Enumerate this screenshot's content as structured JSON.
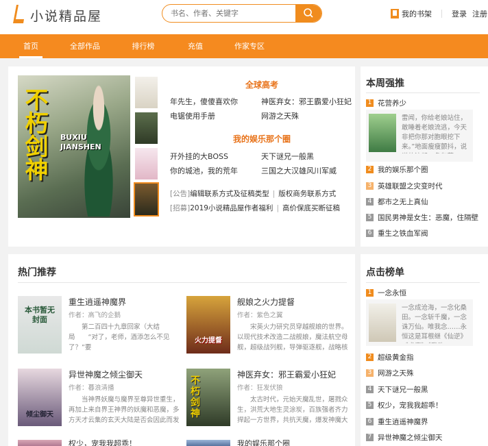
{
  "site": {
    "logo_text": "小说精品屋",
    "accent_color": "#f58a1f"
  },
  "header": {
    "search_placeholder": "书名、作者、关键字",
    "bookshelf_label": "我的书架",
    "login_label": "登录",
    "register_label": "注册"
  },
  "nav": {
    "items": [
      "首页",
      "全部作品",
      "排行榜",
      "充值",
      "作家专区"
    ],
    "active": "首页"
  },
  "featured": {
    "main_cover": {
      "big_text": "不朽剑神",
      "sub_text": "BUXIU JIANSHEN"
    },
    "section1": {
      "title": "全球高考",
      "links": [
        "年先生，傻傻喜欢你",
        "神医弃女：邪王霸爱小狂妃",
        "电锯使用手册",
        "网游之天殊"
      ]
    },
    "section2": {
      "title": "我的娱乐那个圈",
      "links": [
        "开外挂的大BOSS",
        "天下谜兄一般黑",
        "你的城池，我的荒年",
        "三国之大汉雄风川军威"
      ]
    },
    "announcements": [
      {
        "tag": "[公告]",
        "text": "编辑联系方式及征稿类型",
        "extra": "版权商务联系方式"
      },
      {
        "tag": "[招募]",
        "text": "2019小说精品屋作者福利",
        "extra": "高价保底买断征稿"
      }
    ]
  },
  "weekly": {
    "title": "本周强推",
    "top": {
      "rank": "1",
      "name": "花营养少",
      "desc": "雷闻，你给老娘站住，敢睡着老娘流逃，今天非把你那对胞眼挖下来。”地面瘦瘦颤抖，说说的流起一条灰蓝"
    },
    "items": [
      {
        "rank": "2",
        "name": "我的娱乐那个圈"
      },
      {
        "rank": "3",
        "name": "英雄联盟之灾变时代"
      },
      {
        "rank": "4",
        "name": "都市之无上真仙"
      },
      {
        "rank": "5",
        "name": "国民男神是女生：恶魔，住隔壁"
      },
      {
        "rank": "6",
        "name": "重生之铁血军阀"
      }
    ]
  },
  "hot": {
    "title": "热门推荐",
    "books": [
      {
        "title": "重生逍遥神魔界",
        "author": "作者：高飞的企鹅",
        "desc": "第二百四十九章回家（大结局　　“对了，老师，酒添怎么不见了？”要",
        "cover_text": "本书暂无封面"
      },
      {
        "title": "舰娘之火力提督",
        "author": "作者：紫色之翼",
        "desc": "宋英火力研究员穿越舰娘的世界。以现代技术改造二战舰娘，魔法航空母舰，超级战列舰，导弹驱逐舰，战略核潜艇。现代化",
        "cover_text": "火力提督"
      },
      {
        "title": "异世神魔之倾尘御天",
        "author": "作者：暮浪清播",
        "desc": "当神界妖魔与魔界至尊异世重生，再加上来自界王神界的妖魔和恶魔，多方天才云集的玄天大陆是否会因此而发生翻天覆地的",
        "cover_text": "倾尘御天"
      },
      {
        "title": "神医弃女：邪王霸爱小狂妃",
        "author": "作者：狂发伏狼",
        "desc": "太古时代，元始天魔乱世，屠戮众生，洪荒大地生灵涂炭，百族强者齐力捍起一方世界，共抗天魔，爆发神魔大战，众神陨落",
        "cover_text": "不朽剑神"
      }
    ]
  },
  "click_rank": {
    "title": "点击榜单",
    "top": {
      "rank": "1",
      "name": "一念永恒",
      "desc": "一念成沧海，一念化桑田。一念斩千魔，一念诛万仙。唯我念……永恒这是耳根继《仙逆》《求魔》《我欲"
    },
    "items": [
      {
        "rank": "2",
        "name": "超级黄金指"
      },
      {
        "rank": "3",
        "name": "网游之天殊"
      },
      {
        "rank": "4",
        "name": "天下谜兄一般黑"
      },
      {
        "rank": "5",
        "name": "权少，宠我我超乖！"
      },
      {
        "rank": "6",
        "name": "重生逍遥神魔界"
      },
      {
        "rank": "7",
        "name": "异世神魔之倾尘御天"
      }
    ]
  },
  "bottom_peek": {
    "left": "权少，宠我我超乖！",
    "right": "我的娱乐那个圈"
  }
}
